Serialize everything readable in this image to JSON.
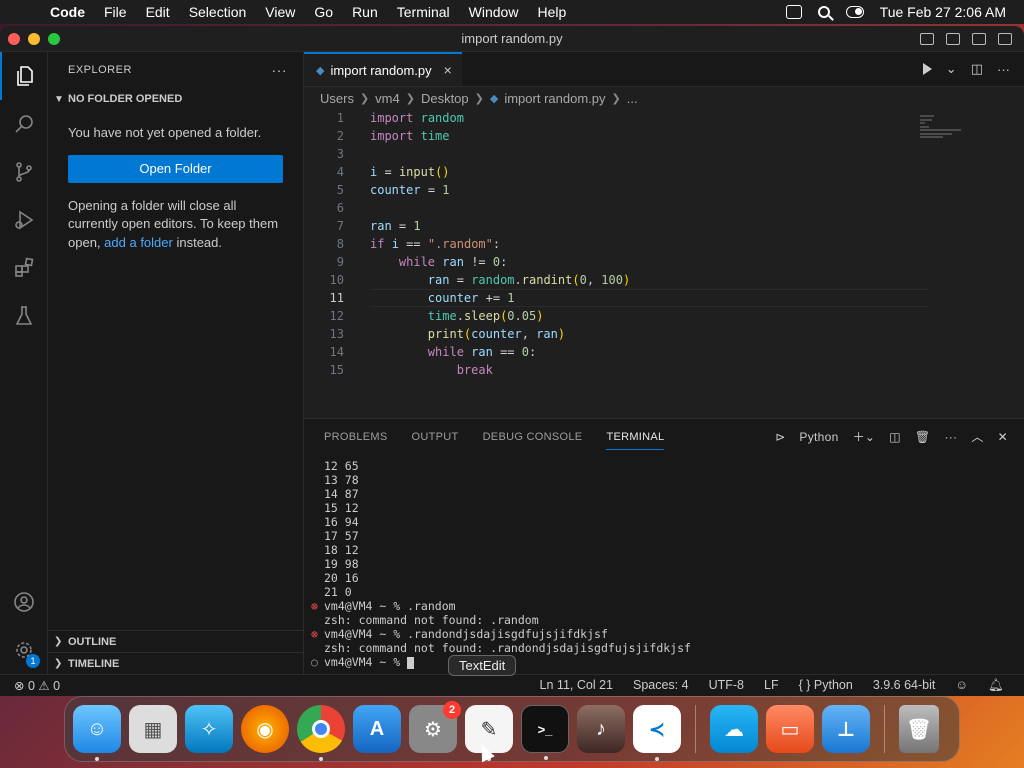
{
  "menubar": {
    "app": "Code",
    "items": [
      "File",
      "Edit",
      "Selection",
      "View",
      "Go",
      "Run",
      "Terminal",
      "Window",
      "Help"
    ],
    "clock": "Tue Feb 27  2:06 AM"
  },
  "window": {
    "title": "import random.py"
  },
  "sidebar": {
    "header": "EXPLORER",
    "section": "NO FOLDER OPENED",
    "msg1": "You have not yet opened a folder.",
    "open_button": "Open Folder",
    "msg2_a": "Opening a folder will close all currently open editors. To keep them open,",
    "msg2_link": "add a folder",
    "msg2_b": "instead.",
    "outline": "OUTLINE",
    "timeline": "TIMELINE"
  },
  "activity": {
    "badge": "1"
  },
  "editor": {
    "tab_label": "import random.py",
    "breadcrumb": [
      "Users",
      "vm4",
      "Desktop",
      "import random.py",
      "..."
    ],
    "current_line": 11
  },
  "panel": {
    "tabs": [
      "PROBLEMS",
      "OUTPUT",
      "DEBUG CONSOLE",
      "TERMINAL"
    ],
    "active_tab": "TERMINAL",
    "shell_label": "Python",
    "terminal_lines": [
      "12 65",
      "13 78",
      "14 87",
      "15 12",
      "16 94",
      "17 57",
      "18 12",
      "19 98",
      "20 16",
      "21 0"
    ],
    "prompt1": "vm4@VM4 ~ % .random",
    "error1": "zsh: command not found: .random",
    "prompt2": "vm4@VM4 ~ % .randondjsdajisgdfujsjifdkjsf",
    "error2": "zsh: command not found: .randondjsdajisgdfujsjifdkjsf",
    "prompt3": "vm4@VM4 ~ % "
  },
  "status": {
    "errors": "0",
    "warnings": "0",
    "position": "Ln 11, Col 21",
    "spaces": "Spaces: 4",
    "encoding": "UTF-8",
    "eol": "LF",
    "language": "Python",
    "interpreter": "3.9.6 64-bit"
  },
  "tooltip": "TextEdit",
  "dock": {
    "settings_badge": "2",
    "items": [
      "Finder",
      "Launchpad",
      "Safari",
      "Firefox",
      "Chrome",
      "App Store",
      "System Settings",
      "TextEdit",
      "Terminal",
      "GarageBand",
      "Visual Studio Code",
      "Weather",
      "Screen Sharing",
      "Keynote",
      "Trash"
    ]
  },
  "colors": {
    "accent": "#0078d4",
    "keyword": "#c586c0",
    "module": "#4ec9b0",
    "function": "#dcdcaa",
    "string": "#ce9178",
    "number": "#b5cea8",
    "variable": "#9cdcfe"
  }
}
